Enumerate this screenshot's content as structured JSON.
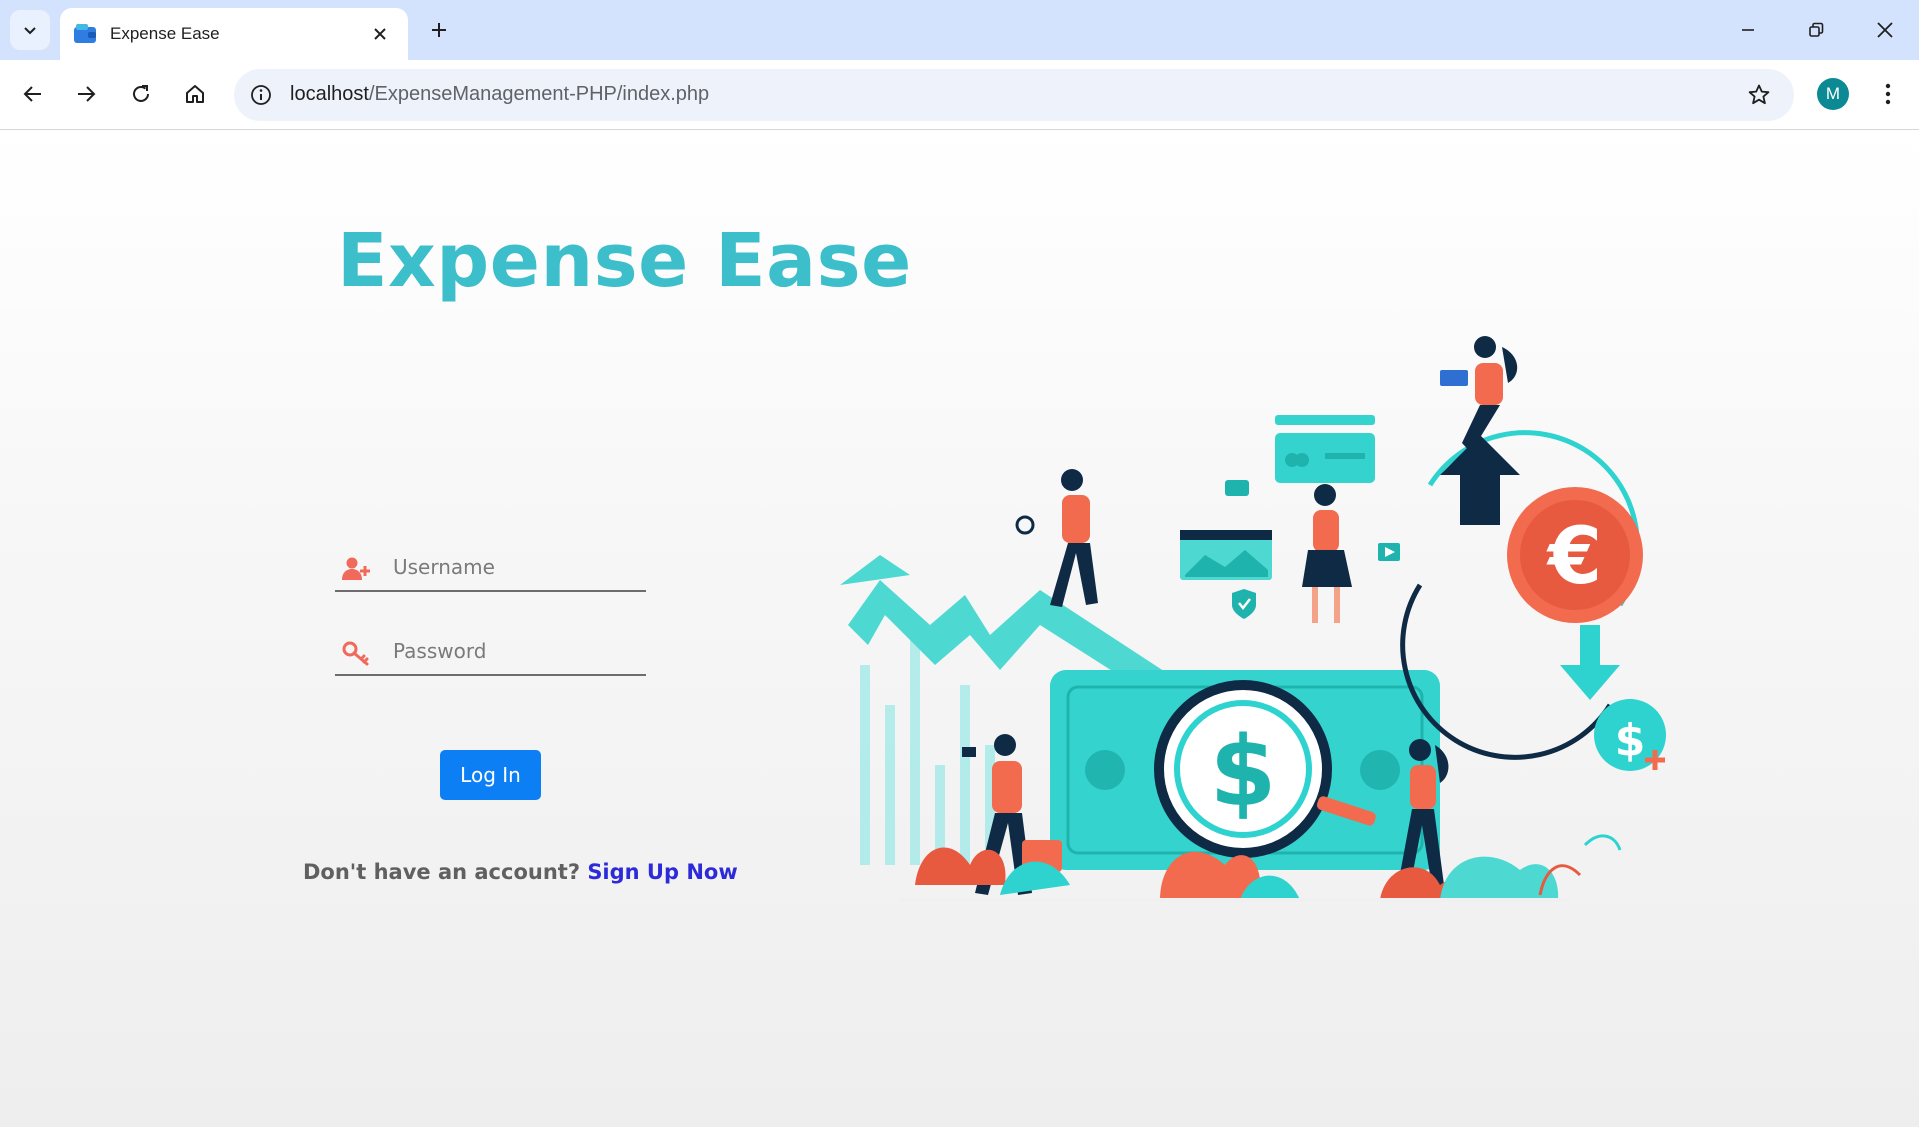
{
  "browser": {
    "tab_title": "Expense Ease",
    "url_host": "localhost",
    "url_path": "/ExpenseManagement-PHP/index.php",
    "profile_initial": "M"
  },
  "page": {
    "brand_title": "Expense Ease",
    "username_placeholder": "Username",
    "password_placeholder": "Password",
    "login_label": "Log In",
    "signup_prompt": "Don't have an account?",
    "signup_link": "Sign Up Now"
  },
  "colors": {
    "brand": "#3cbfca",
    "button": "#0d7ff5",
    "link": "#2d2bd9",
    "icon_red": "#ef6a5a",
    "illustration_teal": "#2ed3cf",
    "illustration_coral": "#f26b4f",
    "illustration_navy": "#0f2a44"
  },
  "icons": {
    "username_icon": "user-plus-icon",
    "password_icon": "key-icon"
  }
}
